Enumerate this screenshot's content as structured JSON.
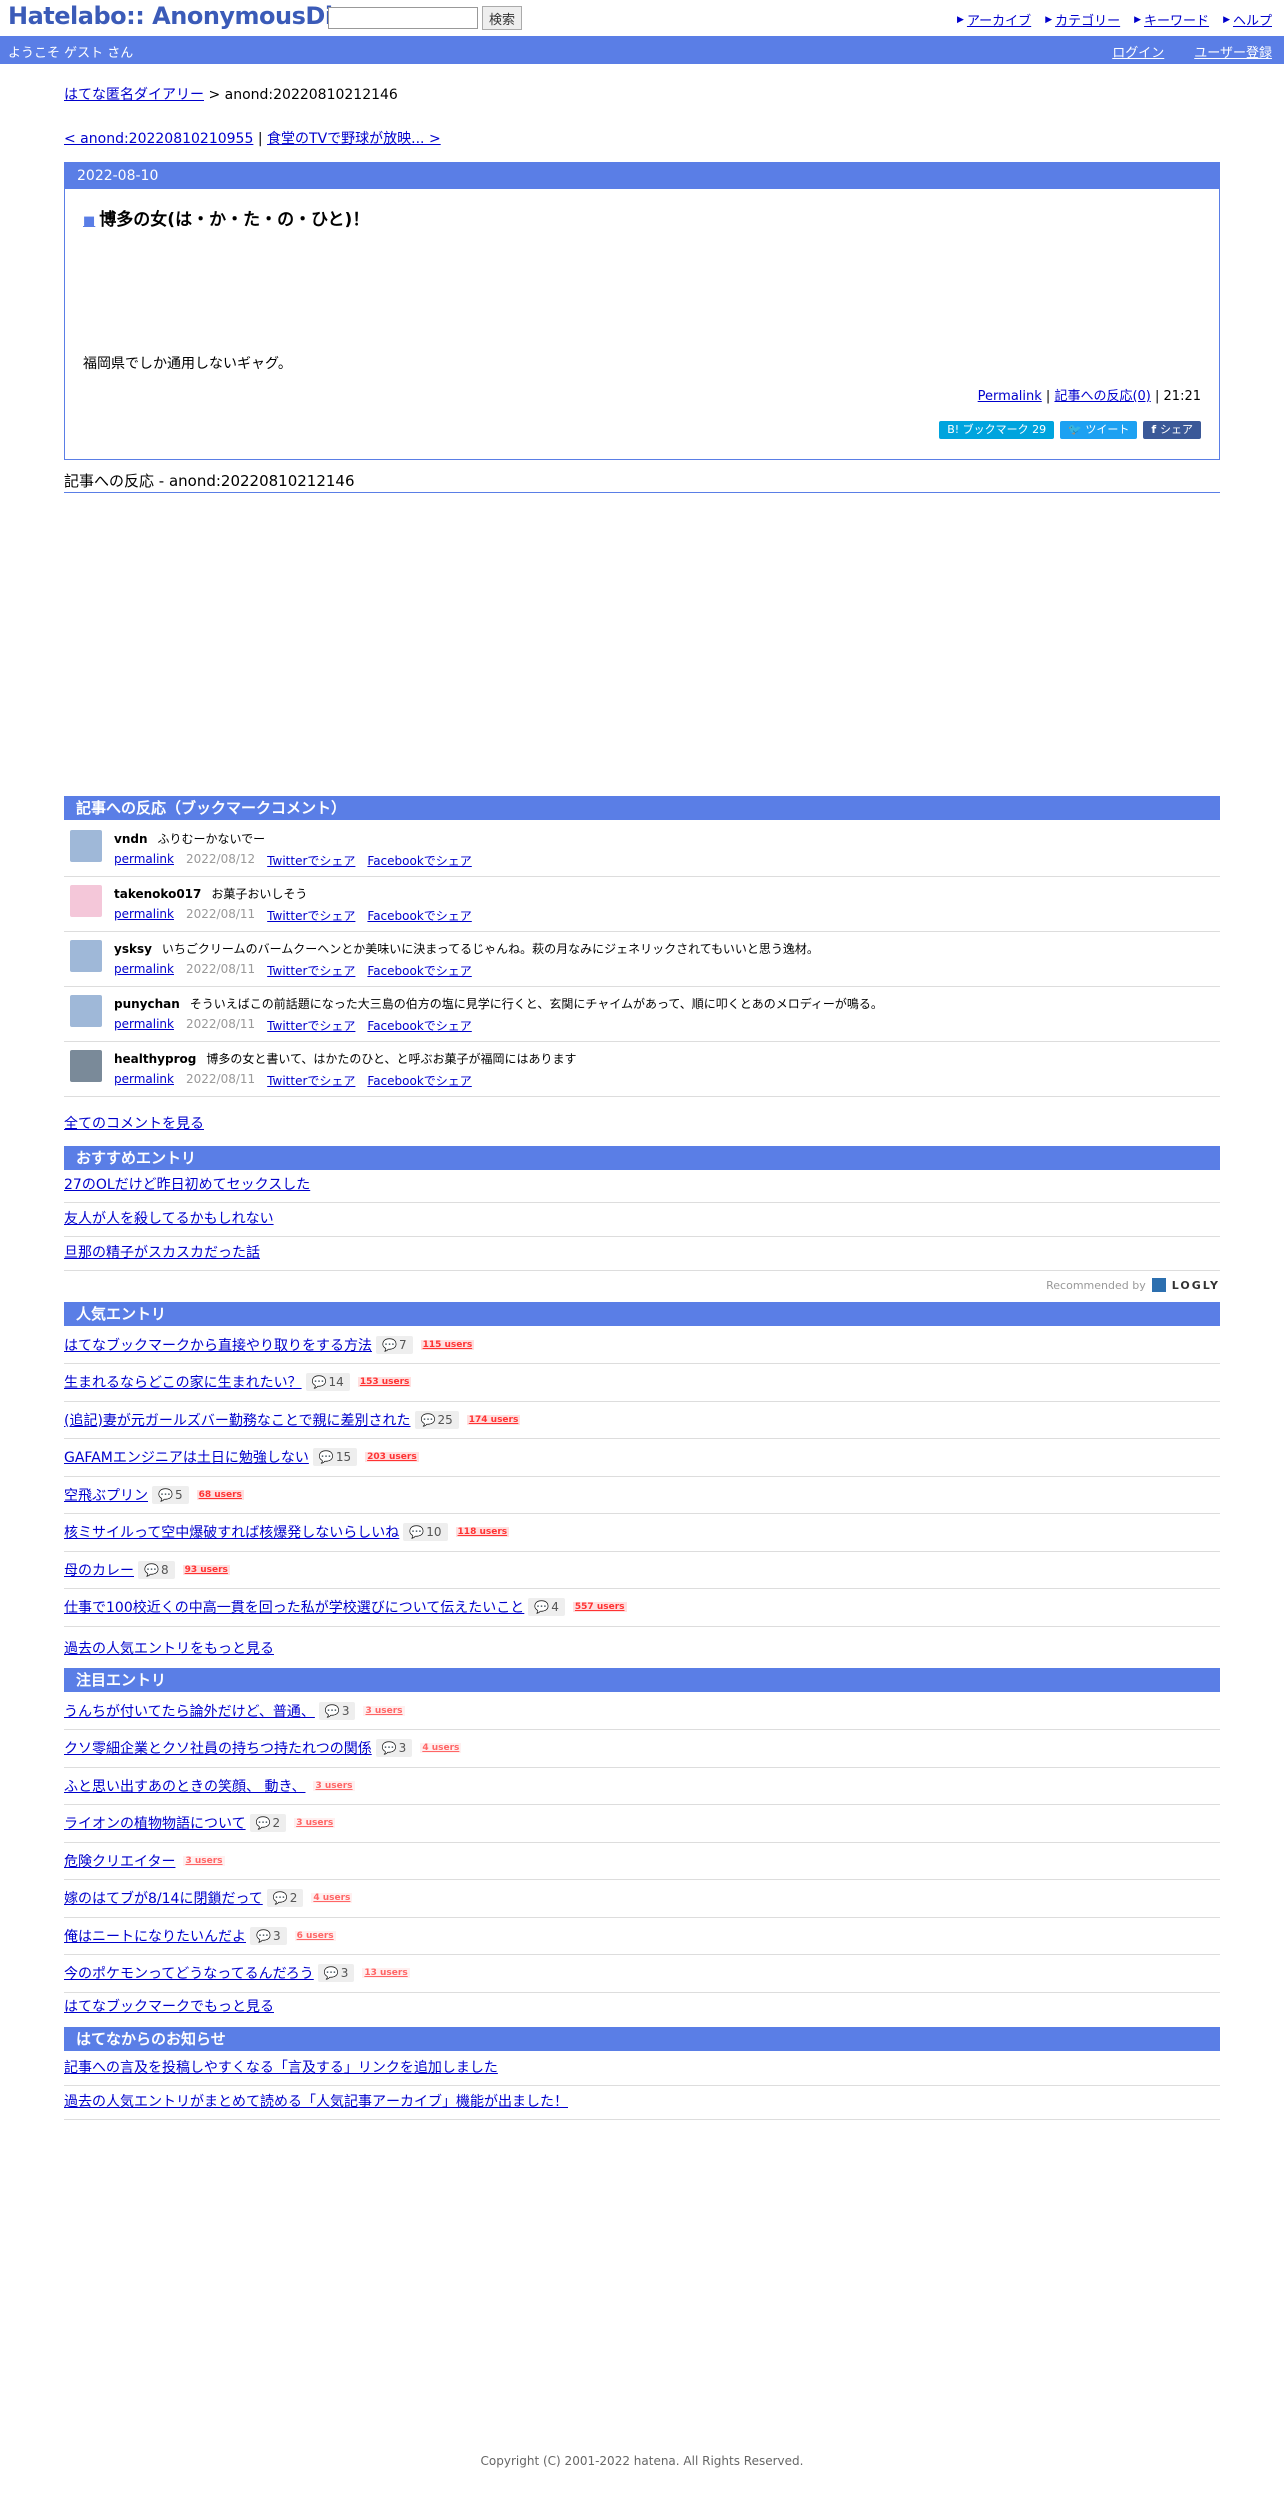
{
  "header": {
    "logo": "Hatelabo:: AnonymousDiary",
    "search_button": "検索",
    "nav": [
      "アーカイブ",
      "カテゴリー",
      "キーワード",
      "ヘルプ"
    ],
    "welcome": "ようこそ ゲスト さん",
    "login": "ログイン",
    "register": "ユーザー登録"
  },
  "breadcrumb": {
    "home": "はてな匿名ダイアリー",
    "sep": ">",
    "current": "anond:20220810212146"
  },
  "pager": {
    "prev": "< anond:20220810210955",
    "sep": "|",
    "next": "食堂のTVで野球が放映... >"
  },
  "entry": {
    "date": "2022-08-10",
    "title": "博多の女(は・か・た・の・ひと)！",
    "body": "福岡県でしか通用しないギャグ。",
    "permalink": "Permalink",
    "reactions": "記事への反応(0)",
    "time": "21:21",
    "share": {
      "bookmark": "B! ブックマーク 29",
      "tweet": "ツイート",
      "facebook": "シェア"
    }
  },
  "reactions_title": "記事への反応 -  anond:20220810212146",
  "bookmark_section": {
    "title": "記事への反応（ブックマークコメント）",
    "comments": [
      {
        "user": "vndn",
        "text": "ふりむーかないでー",
        "date": "2022/08/12"
      },
      {
        "user": "takenoko017",
        "text": "お菓子おいしそう",
        "date": "2022/08/11"
      },
      {
        "user": "ysksy",
        "text": "いちごクリームのバームクーヘンとか美味いに決まってるじゃんね。萩の月なみにジェネリックされてもいいと思う逸材。",
        "date": "2022/08/11"
      },
      {
        "user": "punychan",
        "text": "そういえばこの前話題になった大三島の伯方の塩に見学に行くと、玄関にチャイムがあって、順に叩くとあのメロディーが鳴る。",
        "date": "2022/08/11"
      },
      {
        "user": "healthyprog",
        "text": "博多の女と書いて、はかたのひと、と呼ぶお菓子が福岡にはあります",
        "date": "2022/08/11"
      }
    ],
    "permalink": "permalink",
    "twitter": "Twitterでシェア",
    "facebook": "Facebookでシェア",
    "see_all": "全てのコメントを見る"
  },
  "recommended": {
    "title": "おすすめエントリ",
    "items": [
      "27のOLだけど昨日初めてセックスした",
      "友人が人を殺してるかもしれない",
      "旦那の精子がスカスカだった話"
    ],
    "by": "Recommended by",
    "brand": "LOGLY"
  },
  "popular": {
    "title": "人気エントリ",
    "items": [
      {
        "title": "はてなブックマークから直接やり取りをする方法",
        "comments": "7",
        "users": "115 users"
      },
      {
        "title": "生まれるならどこの家に生まれたい？",
        "comments": "14",
        "users": "153 users"
      },
      {
        "title": "(追記)妻が元ガールズバー勤務なことで親に差別された",
        "comments": "25",
        "users": "174 users"
      },
      {
        "title": "GAFAMエンジニアは土日に勉強しない",
        "comments": "15",
        "users": "203 users"
      },
      {
        "title": "空飛ぶプリン",
        "comments": "5",
        "users": "68 users"
      },
      {
        "title": "核ミサイルって空中爆破すれば核爆発しないらしいね",
        "comments": "10",
        "users": "118 users"
      },
      {
        "title": "母のカレー",
        "comments": "8",
        "users": "93 users"
      },
      {
        "title": "仕事で100校近くの中高一貫を回った私が学校選びについて伝えたいこと",
        "comments": "4",
        "users": "557 users"
      }
    ],
    "more": "過去の人気エントリをもっと見る"
  },
  "notable": {
    "title": "注目エントリ",
    "items": [
      {
        "title": "うんちが付いてたら論外だけど、普通、",
        "comments": "3",
        "users": "3 users"
      },
      {
        "title": "クソ零細企業とクソ社員の持ちつ持たれつの関係",
        "comments": "3",
        "users": "4 users"
      },
      {
        "title": "ふと思い出すあのときの笑顔、 動き、",
        "comments": "",
        "users": "3 users"
      },
      {
        "title": "ライオンの植物物語について",
        "comments": "2",
        "users": "3 users"
      },
      {
        "title": "危険クリエイター",
        "comments": "",
        "users": "3 users"
      },
      {
        "title": "嫁のはてブが8/14に閉鎖だって",
        "comments": "2",
        "users": "4 users"
      },
      {
        "title": "俺はニートになりたいんだよ",
        "comments": "3",
        "users": "6 users"
      },
      {
        "title": "今のポケモンってどうなってるんだろう",
        "comments": "3",
        "users": "13 users"
      }
    ],
    "more": "はてなブックマークでもっと見る"
  },
  "news": {
    "title": "はてなからのお知らせ",
    "items": [
      "記事への言及を投稿しやすくなる「言及する」リンクを追加しました",
      "過去の人気エントリがまとめて読める「人気記事アーカイブ」機能が出ました！"
    ]
  },
  "footer": "Copyright (C) 2001-2022 hatena. All Rights Reserved."
}
